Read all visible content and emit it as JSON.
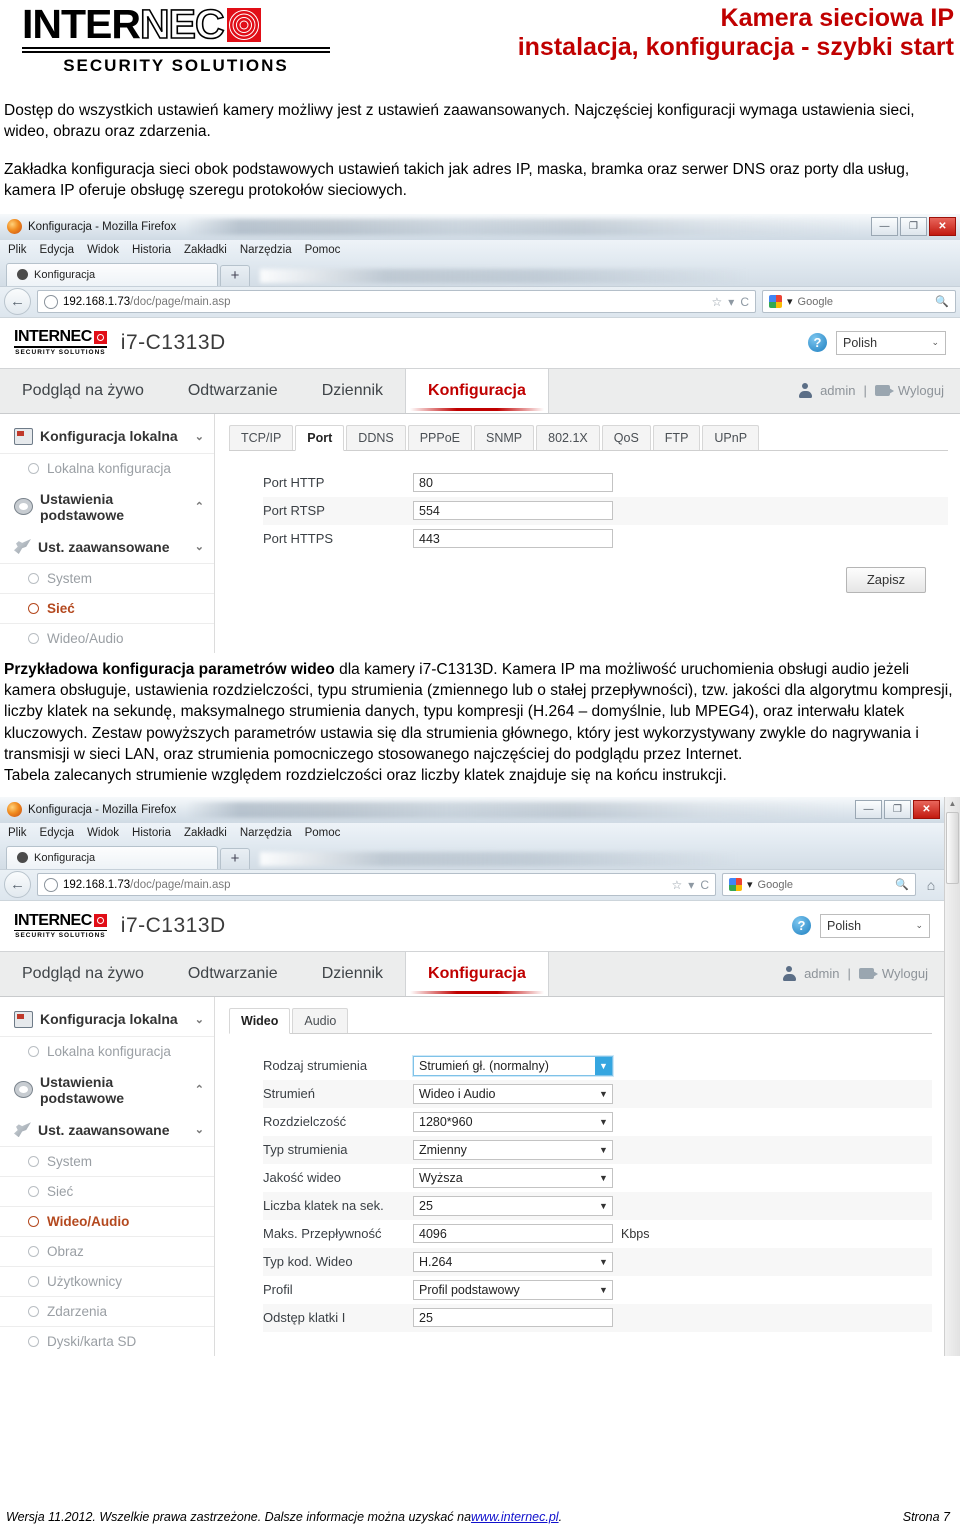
{
  "header": {
    "logo": {
      "text_primary": "INTER",
      "text_secondary": "NEC",
      "tagline": "SECURITY  SOLUTIONS",
      "mark_color": "#e10e17"
    },
    "title_line1": "Kamera sieciowa IP",
    "title_line2": "instalacja, konfiguracja - szybki start",
    "title_color": "#c00000"
  },
  "intro": {
    "paragraph1": "Dostęp do wszystkich ustawień kamery możliwy jest z ustawień zaawansowanych. Najczęściej konfiguracji wymaga ustawienia sieci, wideo, obrazu oraz zdarzenia.",
    "paragraph2": "Zakładka konfiguracja sieci obok podstawowych ustawień takich jak adres IP, maska, bramka oraz serwer DNS oraz porty dla usług, kamera IP oferuje obsługę szeregu protokołów sieciowych."
  },
  "middle_text": {
    "bold_lead": "Przykładowa konfiguracja parametrów wideo",
    "rest": " dla kamery i7-C1313D. Kamera IP ma możliwość uruchomienia obsługi audio jeżeli kamera obsługuje, ustawienia rozdzielczości, typu strumienia (zmiennego lub o stałej przepływności), tzw. jakości dla algorytmu kompresji, liczby klatek na sekundę, maksymalnego strumienia danych, typu kompresji (H.264 – domyślnie, lub MPEG4), oraz interwału klatek kluczowych. Zestaw powyższych parametrów ustawia się dla strumienia głównego, który jest wykorzystywany zwykle do nagrywania i transmisji w sieci LAN, oraz strumienia pomocniczego stosowanego najczęściej do podglądu przez Internet.",
    "last_line": "Tabela zalecanych strumienie względem rozdzielczości oraz liczby klatek znajduje się na końcu instrukcji."
  },
  "browser": {
    "window_title": "Konfiguracja - Mozilla Firefox",
    "menus": [
      "Plik",
      "Edycja",
      "Widok",
      "Historia",
      "Zakładki",
      "Narzędzia",
      "Pomoc"
    ],
    "tab_label": "Konfiguracja",
    "new_tab_label": "+",
    "url_host": "192.168.1.73",
    "url_path": "/doc/page/main.asp",
    "search_placeholder": "Google",
    "win_minimize": "—",
    "win_maximize": "❐",
    "win_close": "✕",
    "back_arrow": "←",
    "star_icon": "☆",
    "dropdown_icon": "▾",
    "reload_icon": "C",
    "search_icon": "🔍",
    "home_icon": "⌂"
  },
  "camera_ui": {
    "logo_primary": "INTER",
    "logo_secondary": "NEC",
    "logo_tagline": "SECURITY SOLUTIONS",
    "model": "i7-C1313D",
    "help_label": "?",
    "language": "Polish",
    "nav": [
      {
        "label": "Podgląd na żywo",
        "active": false
      },
      {
        "label": "Odtwarzanie",
        "active": false
      },
      {
        "label": "Dziennik",
        "active": false
      },
      {
        "label": "Konfiguracja",
        "active": true
      }
    ],
    "user": "admin",
    "separator": "|",
    "logout": "Wyloguj",
    "sidebar": [
      {
        "type": "group",
        "label": "Konfiguracja lokalna",
        "icon": "monitor-icon",
        "arrow": "⌄"
      },
      {
        "type": "item",
        "label": "Lokalna konfiguracja",
        "active": false
      },
      {
        "type": "group",
        "label": "Ustawienia podstawowe",
        "icon": "gear-icon",
        "arrow": "⌃"
      },
      {
        "type": "group",
        "label": "Ust. zaawansowane",
        "icon": "wrench-icon",
        "arrow": "⌄"
      },
      {
        "type": "item",
        "label": "System",
        "active": false
      },
      {
        "type": "item",
        "label": "Sieć",
        "active": false
      },
      {
        "type": "item",
        "label": "Wideo/Audio",
        "active": false
      },
      {
        "type": "item",
        "label": "Obraz",
        "active": false
      },
      {
        "type": "item",
        "label": "Użytkownicy",
        "active": false
      },
      {
        "type": "item",
        "label": "Zdarzenia",
        "active": false
      },
      {
        "type": "item",
        "label": "Dyski/karta SD",
        "active": false
      }
    ]
  },
  "shot1": {
    "active_sidebar": "Sieć",
    "tabs": [
      "TCP/IP",
      "Port",
      "DDNS",
      "PPPoE",
      "SNMP",
      "802.1X",
      "QoS",
      "FTP",
      "UPnP"
    ],
    "active_tab": "Port",
    "fields": [
      {
        "label": "Port HTTP",
        "value": "80"
      },
      {
        "label": "Port RTSP",
        "value": "554"
      },
      {
        "label": "Port HTTPS",
        "value": "443"
      }
    ],
    "save_label": "Zapisz"
  },
  "shot2": {
    "active_sidebar": "Wideo/Audio",
    "tabs": [
      "Wideo",
      "Audio"
    ],
    "active_tab": "Wideo",
    "fields": [
      {
        "label": "Rodzaj strumienia",
        "value": "Strumień gł. (normalny)",
        "control": "select",
        "focused": true
      },
      {
        "label": "Strumień",
        "value": "Wideo i Audio",
        "control": "select"
      },
      {
        "label": "Rozdzielczość",
        "value": "1280*960",
        "control": "select"
      },
      {
        "label": "Typ strumienia",
        "value": "Zmienny",
        "control": "select"
      },
      {
        "label": "Jakość wideo",
        "value": "Wyższa",
        "control": "select"
      },
      {
        "label": "Liczba klatek na sek.",
        "value": "25",
        "control": "select"
      },
      {
        "label": "Maks. Przepływność",
        "value": "4096",
        "control": "input",
        "unit": "Kbps"
      },
      {
        "label": "Typ kod. Wideo",
        "value": "H.264",
        "control": "select"
      },
      {
        "label": "Profil",
        "value": "Profil podstawowy",
        "control": "select"
      },
      {
        "label": "Odstęp klatki I",
        "value": "25",
        "control": "input"
      }
    ]
  },
  "footer": {
    "text_before": "Wersja 11.2012. Wszelkie prawa zastrzeżone. Dalsze informacje można uzyskać na ",
    "link": "www.internec.pl",
    "text_after": " .",
    "page": "Strona 7"
  }
}
